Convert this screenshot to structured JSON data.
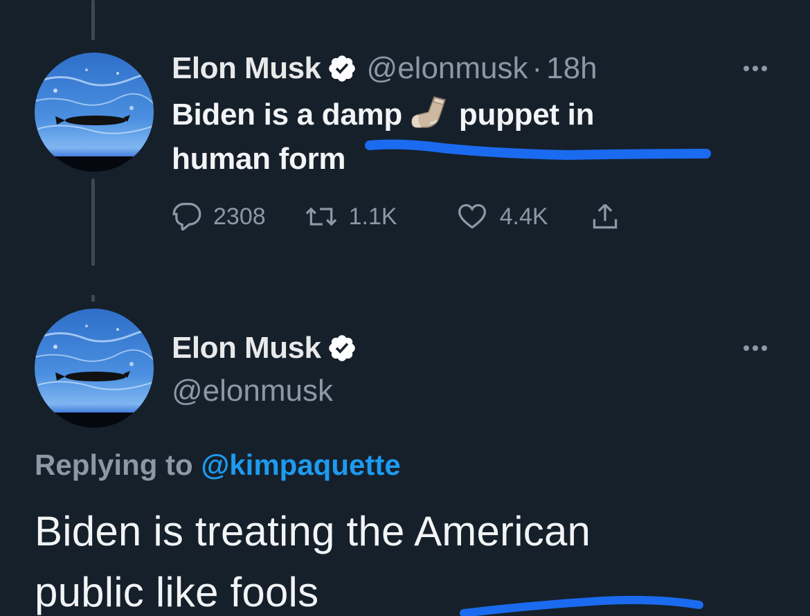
{
  "colors": {
    "background": "#16202b",
    "primary_text": "#e7e9ea",
    "secondary_text": "#8b98a5",
    "link": "#1d9bf0",
    "verified_badge": "#ffffff",
    "highlight_scribble": "#1a6bf0"
  },
  "tweet1": {
    "author": {
      "name": "Elon Musk",
      "handle": "@elonmusk",
      "verified_icon": "verified-badge-icon"
    },
    "separator": "·",
    "time": "18h",
    "text_part1": "Biden is a damp",
    "emoji": "sock-emoji",
    "text_part2": "puppet in",
    "text_line2": "human form",
    "stats": {
      "replies": "2308",
      "retweets": "1.1K",
      "likes": "4.4K"
    },
    "action_icons": [
      "reply-icon",
      "retweet-icon",
      "like-icon",
      "share-icon"
    ]
  },
  "tweet2": {
    "author": {
      "name": "Elon Musk",
      "handle": "@elonmusk"
    },
    "replying_label": "Replying to",
    "replying_to": "@kimpaquette",
    "text_line1": "Biden is treating the American",
    "text_line2": "public like fools"
  }
}
